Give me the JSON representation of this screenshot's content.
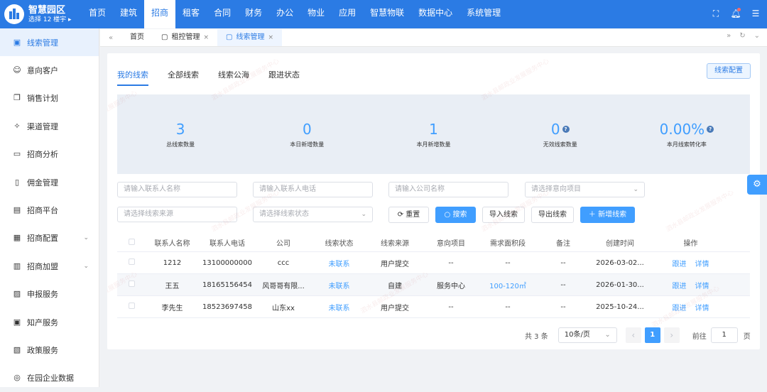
{
  "brand": {
    "title": "智慧园区",
    "subtitle": "选择 12 楼宇 ▸"
  },
  "nav": [
    "首页",
    "建筑",
    "招商",
    "租客",
    "合同",
    "财务",
    "办公",
    "物业",
    "应用",
    "智慧物联",
    "数据中心",
    "系统管理"
  ],
  "sidebar": [
    {
      "label": "线索管理",
      "icon": "clue-icon",
      "active": true
    },
    {
      "label": "意向客户",
      "icon": "user-icon"
    },
    {
      "label": "销售计划",
      "icon": "plan-icon"
    },
    {
      "label": "渠道管理",
      "icon": "channel-icon"
    },
    {
      "label": "招商分析",
      "icon": "monitor-icon"
    },
    {
      "label": "佣金管理",
      "icon": "commission-icon"
    },
    {
      "label": "招商平台",
      "icon": "platform-icon"
    },
    {
      "label": "招商配置",
      "icon": "config-icon",
      "chevron": true
    },
    {
      "label": "招商加盟",
      "icon": "building-icon",
      "chevron": true
    },
    {
      "label": "申报服务",
      "icon": "declare-icon"
    },
    {
      "label": "知产服务",
      "icon": "ip-icon"
    },
    {
      "label": "政策服务",
      "icon": "policy-icon"
    },
    {
      "label": "在园企业数据",
      "icon": "data-icon"
    }
  ],
  "tabs": [
    {
      "label": "首页"
    },
    {
      "label": "租控管理",
      "close": "×"
    },
    {
      "label": "线索管理",
      "close": "×",
      "active": true
    }
  ],
  "subtabs": [
    "我的线索",
    "全部线索",
    "线索公海",
    "跟进状态"
  ],
  "config_button": "线索配置",
  "stats": [
    {
      "value": "3",
      "label": "总线索数量"
    },
    {
      "value": "0",
      "label": "本日新增数量"
    },
    {
      "value": "1",
      "label": "本月新增数量"
    },
    {
      "value": "0",
      "label": "无效线索数量",
      "help": true
    },
    {
      "value": "0.00%",
      "label": "本月线索转化率",
      "help": true
    }
  ],
  "filters": {
    "contact_name": "请输入联系人名称",
    "contact_phone": "请输入联系人电话",
    "company": "请输入公司名称",
    "intent_project": "请选择意向项目",
    "source": "请选择线索来源",
    "status": "请选择线索状态"
  },
  "buttons": {
    "reset": "重置",
    "search": "搜索",
    "import": "导入线索",
    "export": "导出线索",
    "add": "新增线索"
  },
  "table": {
    "headers": [
      "联系人名称",
      "联系人电话",
      "公司",
      "线索状态",
      "线索来源",
      "意向项目",
      "需求面积段",
      "备注",
      "创建时间",
      "操作"
    ],
    "rows": [
      {
        "name": "1212",
        "phone": "13100000000",
        "company": "ccc",
        "status": "未联系",
        "source": "用户提交",
        "project": "--",
        "area": "--",
        "note": "--",
        "created": "2026-03-02..."
      },
      {
        "name": "王五",
        "phone": "18165156454",
        "company": "风哥哥有限...",
        "status": "未联系",
        "source": "自建",
        "project": "服务中心",
        "area": "100-120㎡",
        "note": "--",
        "created": "2026-01-30..."
      },
      {
        "name": "李先生",
        "phone": "18523697458",
        "company": "山东xx",
        "status": "未联系",
        "source": "用户提交",
        "project": "--",
        "area": "--",
        "note": "--",
        "created": "2025-10-24..."
      }
    ],
    "actions": [
      "跟进",
      "详情"
    ]
  },
  "pagination": {
    "total": "共 3 条",
    "page_size": "10条/页",
    "current": "1",
    "goto_label": "前往",
    "goto_value": "1",
    "page_suffix": "页"
  },
  "watermark": "泗水县邮政业发展服务中心",
  "colors": {
    "primary": "#2b7be4",
    "accent": "#409eff"
  }
}
